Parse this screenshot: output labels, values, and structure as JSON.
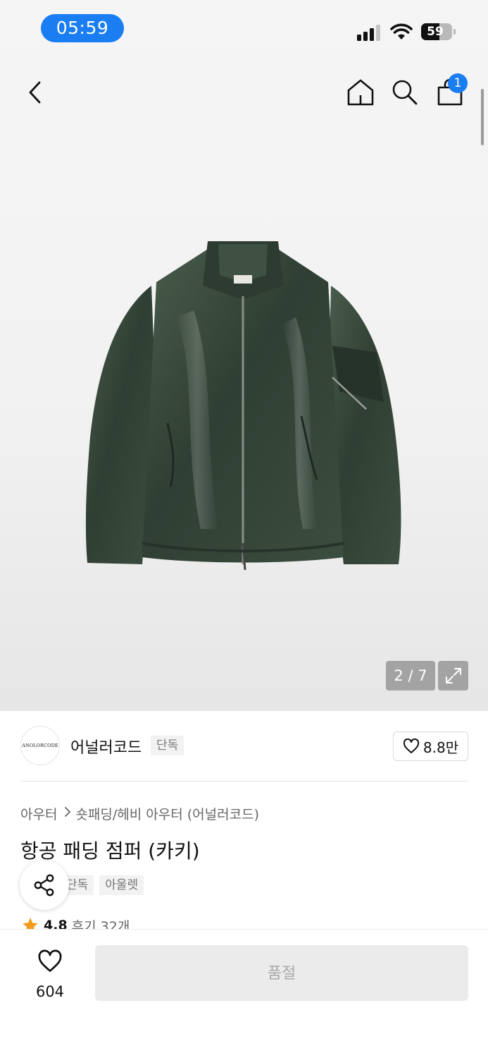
{
  "status_bar": {
    "time": "05:59",
    "battery_percent": "59",
    "battery_level": 0.59,
    "signal_bars": 3,
    "accent_color": "#1a7ef2"
  },
  "nav": {
    "back_icon": "chevron-left-icon",
    "home_icon": "home-icon",
    "search_icon": "search-icon",
    "cart_icon": "shopping-bag-icon",
    "cart_count": "1"
  },
  "gallery": {
    "counter": "2 / 7",
    "current_index": 2,
    "total": 7,
    "expand_icon": "expand-icon",
    "image_description_icon": "jacket-image"
  },
  "brand": {
    "logo_text": "ANOLORCODE",
    "name": "어널러코드",
    "badge": "단독",
    "likes": "8.8만"
  },
  "product": {
    "breadcrumb": [
      "아우터",
      "숏패딩/헤비 아우터 (어널러코드)"
    ],
    "title": "항공 패딩 점퍼 (카키)",
    "tags": [
      "단독",
      "아울렛"
    ],
    "rating": "4.8",
    "reviews": "후기 32개"
  },
  "bottom_bar": {
    "wish_count": "604",
    "buy_label": "품절"
  }
}
